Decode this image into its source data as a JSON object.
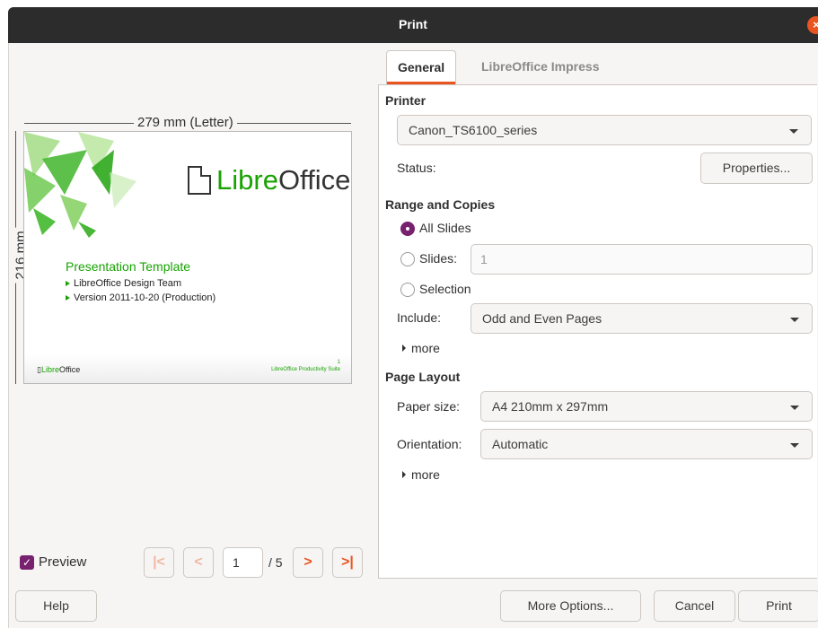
{
  "window": {
    "title": "Print"
  },
  "preview": {
    "width_label": "279 mm (Letter)",
    "height_label": "216 mm",
    "slide": {
      "logo_word_libre": "Libre",
      "logo_word_office": "Office",
      "title": "Presentation Template",
      "bullets": [
        "LibreOffice Design Team",
        "Version 2011-10-20 (Production)"
      ],
      "footer_logo_libre": "Libre",
      "footer_logo_office": "Office",
      "footer_suite": "LibreOffice Productivity Suite",
      "footer_page": "1"
    },
    "preview_checkbox_label": "Preview",
    "preview_checked": true,
    "current_page": "1",
    "page_total": "/ 5"
  },
  "tabs": [
    "General",
    "LibreOffice Impress"
  ],
  "printer": {
    "section": "Printer",
    "selected": "Canon_TS6100_series",
    "status_label": "Status:",
    "properties_button": "Properties..."
  },
  "range": {
    "section": "Range and Copies",
    "all_slides": "All Slides",
    "slides_label": "Slides:",
    "slides_value": "1",
    "selection": "Selection",
    "include_label": "Include:",
    "include_value": "Odd and Even Pages",
    "more": "more"
  },
  "layout": {
    "section": "Page Layout",
    "paper_label": "Paper size:",
    "paper_value": "A4 210mm x 297mm",
    "orientation_label": "Orientation:",
    "orientation_value": "Automatic",
    "more": "more"
  },
  "buttons": {
    "help": "Help",
    "more_options": "More Options...",
    "cancel": "Cancel",
    "print": "Print"
  },
  "colors": {
    "accent": "#e95420",
    "check": "#77216f",
    "libre_green": "#18a303"
  }
}
